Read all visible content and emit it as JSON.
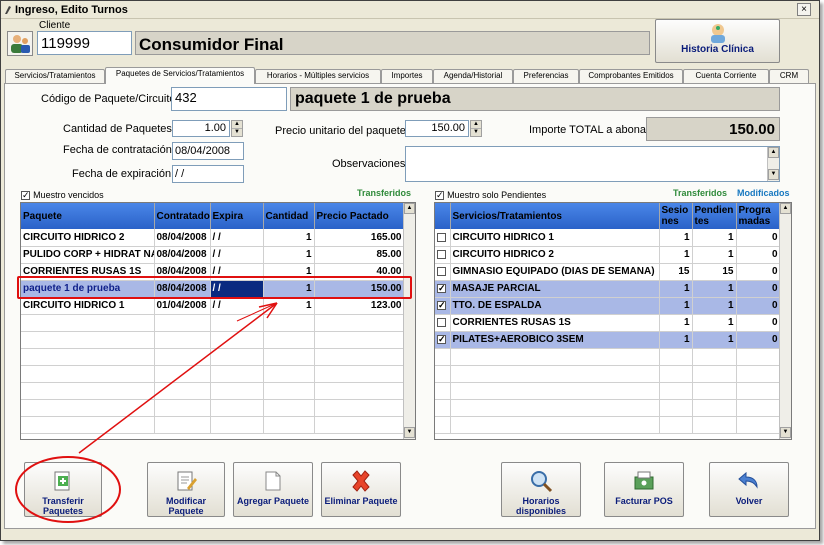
{
  "window": {
    "title": "Ingreso, Edito Turnos",
    "close_glyph": "×"
  },
  "cliente": {
    "label": "Cliente",
    "code": "119999",
    "name": "Consumidor Final"
  },
  "historia_button": "Historia Clínica",
  "tabs": [
    "Servicios/Tratamientos",
    "Paquetes de Servicios/Tratamientos",
    "Horarios - Múltiples servicios",
    "Importes",
    "Agenda/Historial",
    "Preferencias",
    "Comprobantes Emitidos",
    "Cuenta Corriente",
    "CRM"
  ],
  "form": {
    "codigo_label": "Código de Paquete/Circuito",
    "codigo_value": "432",
    "paquete_name": "paquete 1 de prueba",
    "cantidad_label": "Cantidad de Paquetes",
    "cantidad_value": "1.00",
    "precio_label": "Precio unitario del paquete",
    "precio_value": "150.00",
    "importe_label": "Importe TOTAL a abonar",
    "importe_value": "150.00",
    "contratacion_label": "Fecha de contratación",
    "contratacion_value": "08/04/2008",
    "expiracion_label": "Fecha de expiración",
    "expiracion_value": " / /",
    "observaciones_label": "Observaciones",
    "observaciones_value": ""
  },
  "left_grid": {
    "check_label": "Muestro vencidos",
    "status": "Transferidos",
    "headers": [
      "Paquete",
      "Contratado",
      "Expira",
      "Cantidad",
      "Precio Pactado"
    ],
    "rows": [
      [
        "CIRCUITO HIDRICO 2",
        "08/04/2008",
        " / /",
        "1",
        "165.00"
      ],
      [
        "PULIDO CORP + HIDRAT NAC",
        "08/04/2008",
        " / /",
        "1",
        "85.00"
      ],
      [
        "CORRIENTES RUSAS 1S",
        "08/04/2008",
        " / /",
        "1",
        "40.00"
      ],
      [
        "paquete 1 de prueba",
        "08/04/2008",
        " / /",
        "1",
        "150.00"
      ],
      [
        "CIRCUITO HIDRICO 1",
        "01/04/2008",
        " / /",
        "1",
        "123.00"
      ]
    ],
    "selected_row": 3
  },
  "right_grid": {
    "check_label": "Muestro solo Pendientes",
    "status_transferidos": "Transferidos",
    "status_modificados": "Modificados",
    "headers": [
      "Servicios/Tratamientos",
      "Sesio nes",
      "Pendien tes",
      "Progra madas"
    ],
    "rows": [
      {
        "checked": false,
        "cells": [
          "CIRCUITO HIDRICO 1",
          "1",
          "1",
          "0"
        ]
      },
      {
        "checked": false,
        "cells": [
          "CIRCUITO HIDRICO 2",
          "1",
          "1",
          "0"
        ]
      },
      {
        "checked": false,
        "cells": [
          "GIMNASIO EQUIPADO (DIAS DE SEMANA)",
          "15",
          "15",
          "0"
        ]
      },
      {
        "checked": true,
        "cells": [
          "MASAJE PARCIAL",
          "1",
          "1",
          "0"
        ]
      },
      {
        "checked": true,
        "cells": [
          "TTO. DE ESPALDA",
          "1",
          "1",
          "0"
        ]
      },
      {
        "checked": false,
        "cells": [
          "CORRIENTES RUSAS 1S",
          "1",
          "1",
          "0"
        ]
      },
      {
        "checked": true,
        "cells": [
          "PILATES+AEROBICO 3SEM",
          "1",
          "1",
          "0"
        ]
      }
    ]
  },
  "buttons": {
    "transferir": "Transferir Paquetes",
    "modificar": "Modificar Paquete",
    "agregar": "Agregar Paquete",
    "eliminar": "Eliminar Paquete",
    "horarios": "Horarios disponibles",
    "facturar": "Facturar POS",
    "volver": "Volver"
  },
  "colors": {
    "header": "#2a62c8",
    "selected": "#a9b8e6",
    "annotation": "#e01010"
  }
}
